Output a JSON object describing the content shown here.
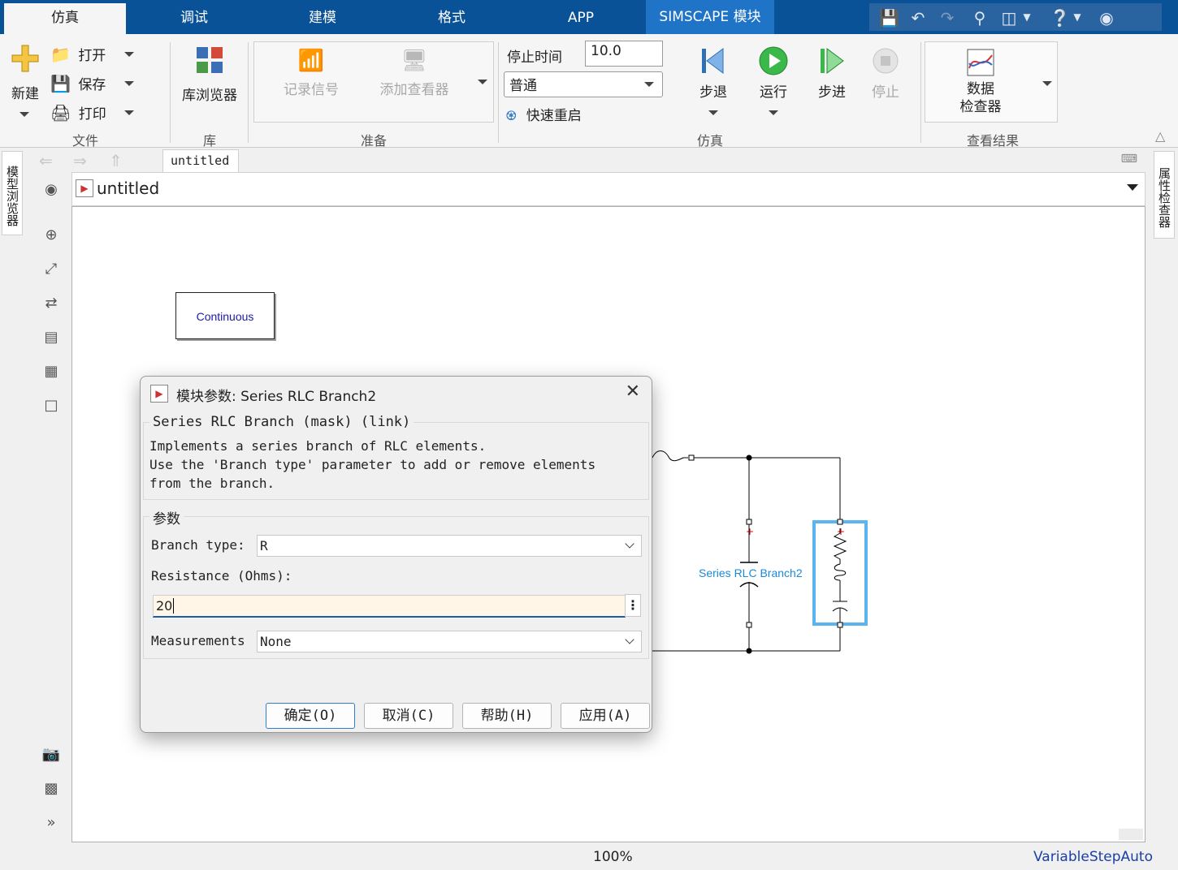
{
  "tabs": [
    "仿真",
    "调试",
    "建模",
    "格式",
    "APP",
    "SIMSCAPE 模块"
  ],
  "ribbon": {
    "file": {
      "new": "新建",
      "open": "打开",
      "save": "保存",
      "print": "打印",
      "label": "文件"
    },
    "library": {
      "browser": "库浏览器",
      "label": "库"
    },
    "prepare": {
      "log_signals": "记录信号",
      "add_viewer": "添加查看器",
      "label": "准备"
    },
    "simulate": {
      "stop_time_label": "停止时间",
      "stop_time_value": "10.0",
      "mode": "普通",
      "fast_restart": "快速重启",
      "step_back": "步退",
      "run": "运行",
      "step_forward": "步进",
      "stop": "停止",
      "label": "仿真"
    },
    "results": {
      "data_inspector": "数据\n检查器",
      "data_inspector_l1": "数据",
      "data_inspector_l2": "检查器",
      "label": "查看结果"
    }
  },
  "left_panel": {
    "model_browser": "模型浏览器"
  },
  "right_panel": {
    "property_inspector": "属性检查器"
  },
  "editor": {
    "tab": "untitled",
    "address": "untitled",
    "zoom": "100%",
    "solver": "VariableStepAuto"
  },
  "canvas": {
    "continuous_block": "Continuous",
    "rlc_label": "Series RLC Branch2"
  },
  "dialog": {
    "title": "模块参数: Series RLC Branch2",
    "group_title": "Series RLC Branch (mask) (link)",
    "description": "Implements a series branch of RLC elements.\nUse the 'Branch type' parameter to add or remove elements\nfrom the branch.",
    "params_label": "参数",
    "branch_type_label": "Branch type:",
    "branch_type_value": "R",
    "resistance_label": "Resistance (Ohms):",
    "resistance_value": "20",
    "measurements_label": "Measurements",
    "measurements_value": "None",
    "buttons": {
      "ok": "确定(O)",
      "cancel": "取消(C)",
      "help": "帮助(H)",
      "apply": "应用(A)"
    }
  },
  "colors": {
    "tabbar": "#0a5298",
    "simscape_tab": "#1f74c8",
    "selection": "#5ab4f0",
    "block_label": "#1a8ad8"
  }
}
